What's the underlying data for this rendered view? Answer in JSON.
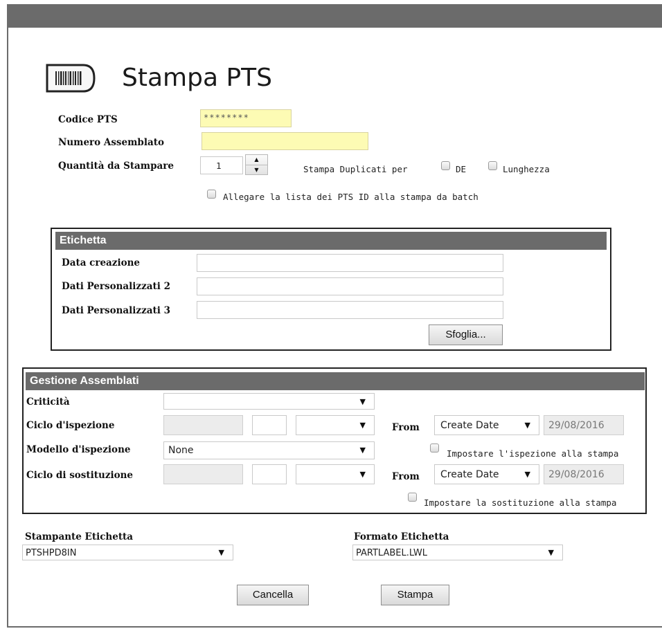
{
  "page": {
    "title": "Stampa PTS"
  },
  "form": {
    "codice_label": "Codice PTS",
    "codice_value": "********",
    "numero_label": "Numero Assemblato",
    "numero_value": "",
    "quantita_label": "Quantità da Stampare",
    "quantita_value": "1",
    "dup_label": "Stampa Duplicati per",
    "dup_de": "DE",
    "dup_lunghezza": "Lunghezza",
    "allegare_label": "Allegare la lista dei PTS ID alla stampa da batch"
  },
  "etichetta": {
    "header": "Etichetta",
    "data_creazione": "Data creazione",
    "dati2": "Dati  Personalizzati 2",
    "dati3": "Dati  Personalizzati 3",
    "sfoglia": "Sfoglia..."
  },
  "gestione": {
    "header": "Gestione Assemblati",
    "criticita": "Criticità",
    "ciclo_ispezione": "Ciclo d'ispezione",
    "modello_ispezione": "Modello d'ispezione",
    "modello_value": "None",
    "ciclo_sostituzione": "Ciclo di sostituzione",
    "from1": "From",
    "from1_select": "Create Date",
    "from1_date": "29/08/2016",
    "from2": "From",
    "from2_select": "Create Date",
    "from2_date": "29/08/2016",
    "impostare_ispezione": "Impostare l'ispezione alla stampa",
    "impostare_sostituzione": "Impostare la sostituzione alla stampa"
  },
  "bottom": {
    "stampante_label": "Stampante Etichetta",
    "stampante_value": "PTSHPD8IN",
    "formato_label": "Formato Etichetta",
    "formato_value": "PARTLABEL.LWL",
    "cancella": "Cancella",
    "stampa": "Stampa"
  },
  "icons": {
    "title_icon": "barcode-label-icon",
    "caret": "▼",
    "spin_up": "▲",
    "spin_down": "▼"
  }
}
